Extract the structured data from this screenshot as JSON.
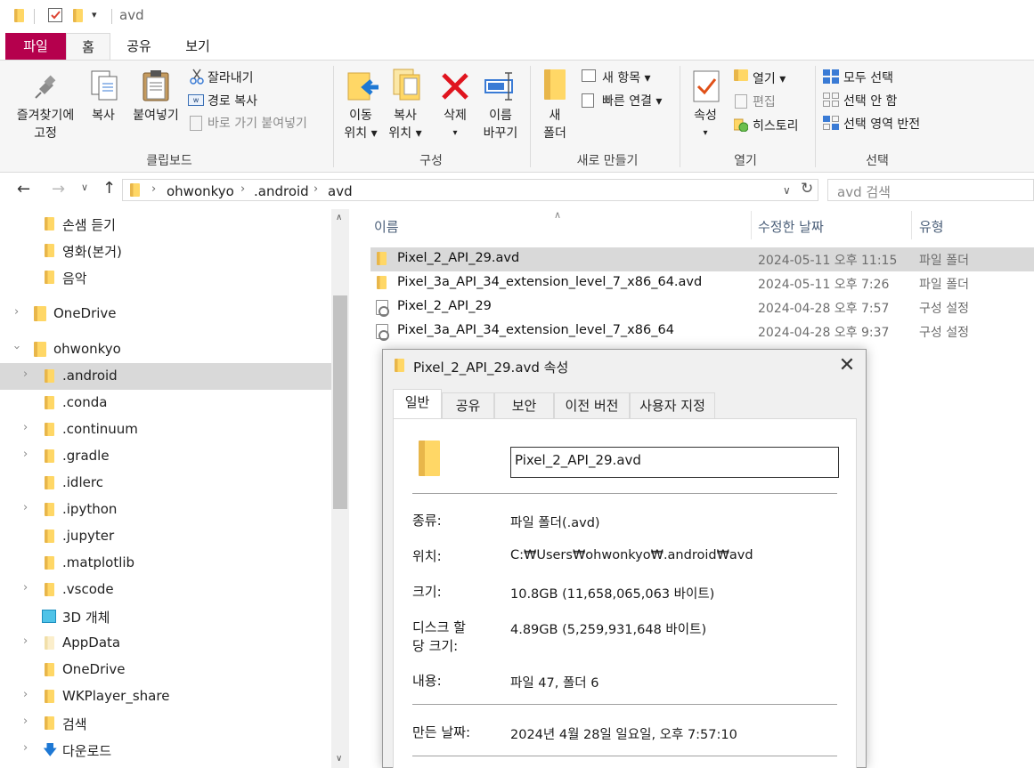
{
  "window": {
    "title": "avd"
  },
  "ribbon_tabs": [
    "파일",
    "홈",
    "공유",
    "보기"
  ],
  "ribbon": {
    "clipboard": {
      "pin_label_1": "즐겨찾기에",
      "pin_label_2": "고정",
      "copy_label": "복사",
      "paste_label": "붙여넣기",
      "cut_label": "잘라내기",
      "copy_path_label": "경로 복사",
      "paste_shortcut_label": "바로 가기 붙여넣기",
      "group_label": "클립보드"
    },
    "organize": {
      "move_label_1": "이동",
      "move_label_2": "위치 ▾",
      "copyto_label_1": "복사",
      "copyto_label_2": "위치 ▾",
      "delete_label": "삭제",
      "delete_arrow": "▾",
      "rename_label_1": "이름",
      "rename_label_2": "바꾸기",
      "group_label": "구성"
    },
    "new": {
      "new_folder_label_1": "새",
      "new_folder_label_2": "폴더",
      "new_item_label": "새 항목 ▾",
      "easy_access_label": "빠른 연결 ▾",
      "group_label": "새로 만들기"
    },
    "open": {
      "properties_label": "속성",
      "properties_arrow": "▾",
      "open_label": "열기 ▾",
      "edit_label": "편집",
      "history_label": "히스토리",
      "group_label": "열기"
    },
    "select": {
      "select_all_label": "모두 선택",
      "select_none_label": "선택 안 함",
      "invert_label": "선택 영역 반전",
      "group_label": "선택"
    }
  },
  "address": {
    "crumbs": [
      "ohwonkyo",
      ".android",
      "avd"
    ],
    "search_placeholder": "avd 검색"
  },
  "nav": {
    "items": [
      {
        "label": "손샘 듣기"
      },
      {
        "label": "영화(본거)"
      },
      {
        "label": "음악"
      },
      {
        "label": "OneDrive"
      },
      {
        "label": "ohwonkyo"
      },
      {
        "label": ".android"
      },
      {
        "label": ".conda"
      },
      {
        "label": ".continuum"
      },
      {
        "label": ".gradle"
      },
      {
        "label": ".idlerc"
      },
      {
        "label": ".ipython"
      },
      {
        "label": ".jupyter"
      },
      {
        "label": ".matplotlib"
      },
      {
        "label": ".vscode"
      },
      {
        "label": "3D 개체"
      },
      {
        "label": "AppData"
      },
      {
        "label": "OneDrive"
      },
      {
        "label": "WKPlayer_share"
      },
      {
        "label": "검색"
      },
      {
        "label": "다운로드"
      }
    ]
  },
  "filelist": {
    "headers": {
      "name": "이름",
      "modified": "수정한 날짜",
      "type": "유형"
    },
    "rows": [
      {
        "name": "Pixel_2_API_29.avd",
        "date": "2024-05-11 오후 11:15",
        "type": "파일 폴더"
      },
      {
        "name": "Pixel_3a_API_34_extension_level_7_x86_64.avd",
        "date": "2024-05-11 오후 7:26",
        "type": "파일 폴더"
      },
      {
        "name": "Pixel_2_API_29",
        "date": "2024-04-28 오후 7:57",
        "type": "구성 설정"
      },
      {
        "name": "Pixel_3a_API_34_extension_level_7_x86_64",
        "date": "2024-04-28 오후 9:37",
        "type": "구성 설정"
      }
    ]
  },
  "dialog": {
    "title": "Pixel_2_API_29.avd 속성",
    "tabs": [
      "일반",
      "공유",
      "보안",
      "이전 버전",
      "사용자 지정"
    ],
    "name_value": "Pixel_2_API_29.avd",
    "type_label": "종류:",
    "type_value": "파일 폴더(.avd)",
    "location_label": "위치:",
    "location_value": "C:₩Users₩ohwonkyo₩.android₩avd",
    "size_label": "크기:",
    "size_value": "10.8GB (11,658,065,063 바이트)",
    "disk_size_label_1": "디스크 할",
    "disk_size_label_2": "당 크기:",
    "disk_size_value": "4.89GB (5,259,931,648 바이트)",
    "contains_label": "내용:",
    "contains_value": "파일 47, 폴더 6",
    "created_label": "만든 날짜:",
    "created_value": "2024년 4월 28일 일요일, 오후 7:57:10"
  },
  "colors": {
    "file_tab": "#b5004d",
    "folder": "#ffd766",
    "selection": "#d9d9d9",
    "delete_x": "#e0141e"
  }
}
